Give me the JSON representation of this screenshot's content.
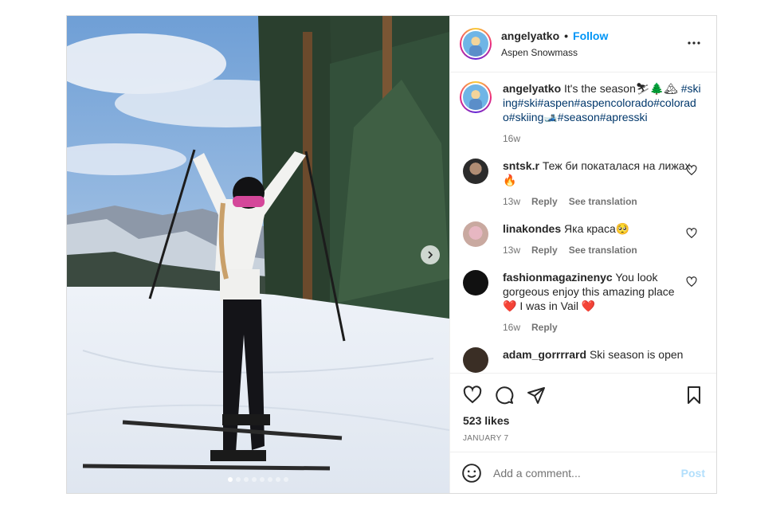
{
  "header": {
    "username": "angelyatko",
    "separator": "•",
    "follow_label": "Follow",
    "location": "Aspen Snowmass",
    "more_icon": "more-horizontal-icon"
  },
  "caption": {
    "username": "angelyatko",
    "text": "It's the season⛷🌲🏔",
    "hashtags": "#skiing#ski#aspen#aspencolorado#colorado#skiing🎿#season#apresski",
    "time": "16w"
  },
  "comments": [
    {
      "username": "sntsk.r",
      "text": "Теж би покаталася на лижах 🔥",
      "time": "13w",
      "reply": "Reply",
      "translate": "See translation"
    },
    {
      "username": "linakondes",
      "text": "Яка краса🥺",
      "time": "13w",
      "reply": "Reply",
      "translate": "See translation"
    },
    {
      "username": "fashionmagazinenyc",
      "text": "You look gorgeous enjoy this amazing place ❤️ I was in Vail ❤️",
      "time": "16w",
      "reply": "Reply"
    },
    {
      "username": "adam_gorrrrard",
      "text": "Ski season is open"
    }
  ],
  "actions": {
    "likes": "523 likes",
    "date": "JANUARY 7"
  },
  "add_comment": {
    "placeholder": "Add a comment...",
    "post_label": "Post"
  },
  "carousel": {
    "slide_count": 8,
    "active_index": 0
  },
  "colors": {
    "accent": "#0095f6",
    "hashtag": "#00376b",
    "muted": "#737373"
  }
}
